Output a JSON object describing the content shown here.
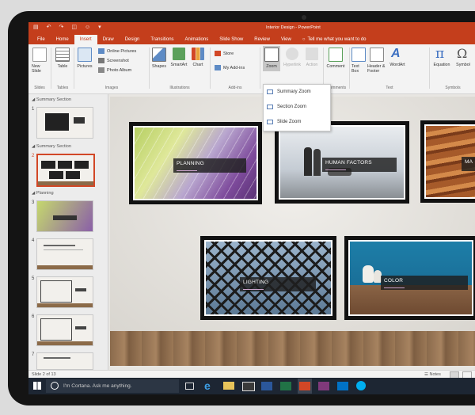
{
  "window": {
    "title": "Interior Design - PowerPoint"
  },
  "quick_access": [
    "save-icon",
    "undo-icon",
    "redo-icon",
    "present-icon",
    "user-icon",
    "dropdown-icon"
  ],
  "tell_me": "Tell me what you want to do",
  "tabs": [
    "File",
    "Home",
    "Insert",
    "Draw",
    "Design",
    "Transitions",
    "Animations",
    "Slide Show",
    "Review",
    "View"
  ],
  "active_tab": "Insert",
  "ribbon": {
    "new_slide": "New Slide",
    "table": "Table",
    "pictures": "Pictures",
    "online_pictures": "Online Pictures",
    "screenshot": "Screenshot",
    "photo_album": "Photo Album",
    "shapes": "Shapes",
    "smartart": "SmartArt",
    "chart": "Chart",
    "store": "Store",
    "my_addins": "My Add-ins",
    "zoom": "Zoom",
    "hyperlink": "Hyperlink",
    "action": "Action",
    "comment": "Comment",
    "text_box": "Text Box",
    "header_footer": "Header & Footer",
    "wordart": "WordArt",
    "equation": "Equation",
    "symbol": "Symbol",
    "groups": {
      "slides": "Slides",
      "tables": "Tables",
      "images": "Images",
      "illustrations": "Illustrations",
      "addins": "Add-ins",
      "comments": "Comments",
      "text": "Text",
      "symbols": "Symbols"
    }
  },
  "zoom_menu": [
    "Summary Zoom",
    "Section Zoom",
    "Slide Zoom"
  ],
  "thumbnails": {
    "sections": [
      "Summary Section",
      "Summary Section",
      "Planning"
    ],
    "numbers": [
      "1",
      "2",
      "3",
      "4",
      "5",
      "6",
      "7"
    ]
  },
  "slide": {
    "frames": [
      {
        "caption": "PLANNING"
      },
      {
        "caption": "HUMAN FACTORS"
      },
      {
        "caption": "MA"
      },
      {
        "caption": "LIGHTING"
      },
      {
        "caption": "COLOR"
      }
    ]
  },
  "status": {
    "slide_info": "Slide 2 of 13",
    "notes": "Notes"
  },
  "taskbar": {
    "cortana": "I'm Cortana. Ask me anything."
  },
  "colors": {
    "accent": "#c43e1c",
    "selection": "#d24726",
    "taskbar": "#1d2633"
  }
}
